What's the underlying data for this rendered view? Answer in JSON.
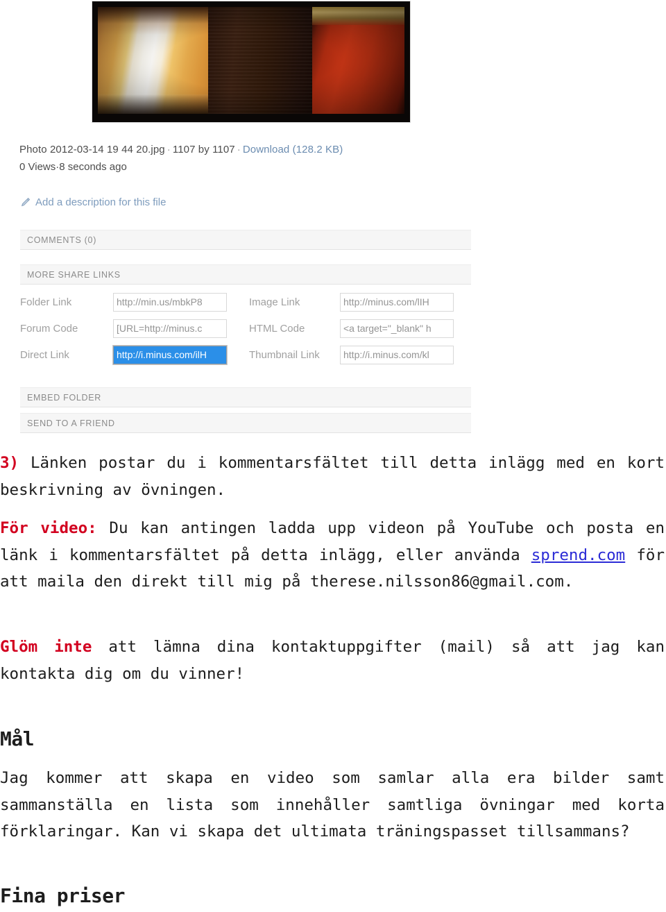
{
  "screenshot": {
    "photo": {
      "alt_name": "uploaded-photo-preview"
    },
    "file_meta": {
      "filename": "Photo 2012-03-14 19 44 20.jpg",
      "dimensions": "1107 by 1107",
      "download_label": "Download (128.2 KB)",
      "views": "0 Views",
      "uploaded": "8 seconds ago",
      "separator": "·"
    },
    "description_link": "Add a description for this file",
    "bars": {
      "comments": "COMMENTS (0)",
      "more_share_links": "MORE SHARE LINKS",
      "embed_folder": "EMBED FOLDER",
      "send_to_a_friend": "SEND TO A FRIEND"
    },
    "share_links": [
      {
        "left_label": "Folder Link",
        "left_value": "http://min.us/mbkP8",
        "right_label": "Image Link",
        "right_value": "http://minus.com/lIH"
      },
      {
        "left_label": "Forum Code",
        "left_value": "[URL=http://minus.c",
        "right_label": "HTML Code",
        "right_value": "<a target=\"_blank\" h"
      },
      {
        "left_label": "Direct Link",
        "left_value": "http://i.minus.com/ilH",
        "right_label": "Thumbnail Link",
        "right_value": "http://i.minus.com/kl"
      }
    ],
    "focused_field": "Direct Link",
    "colors": {
      "selection_blue": "#2b8fe8",
      "link_blue": "#6b8cb0",
      "bar_bg": "#f6f6f6"
    }
  },
  "article": {
    "p1": {
      "marker": "3)",
      "text": " Länken postar du i kommentarsfältet till detta inlägg med en kort beskrivning av övningen."
    },
    "p2": {
      "lead": "För video:",
      "text_a": " Du kan antingen ladda upp videon på YouTube och posta en länk i kommentarsfältet på detta inlägg, eller använda ",
      "link": "sprend.com",
      "text_b": " för att maila den direkt till mig på therese.nilsson86@gmail.com."
    },
    "p3": {
      "lead": "Glöm inte",
      "text": " att lämna dina kontaktuppgifter (mail) så att jag kan kontakta dig om du vinner!"
    },
    "heading_mal": "Mål",
    "p4": {
      "text": "Jag kommer att skapa en video som samlar alla era bilder samt sammanställa en lista som innehåller samtliga övningar med korta förklaringar. Kan vi skapa det ultimata träningspasset tillsammans?"
    },
    "heading_fina": "Fina priser",
    "colors": {
      "accent_red": "#d2001f",
      "link_blue": "#2b2bd6",
      "text": "#1d1d1d"
    }
  }
}
